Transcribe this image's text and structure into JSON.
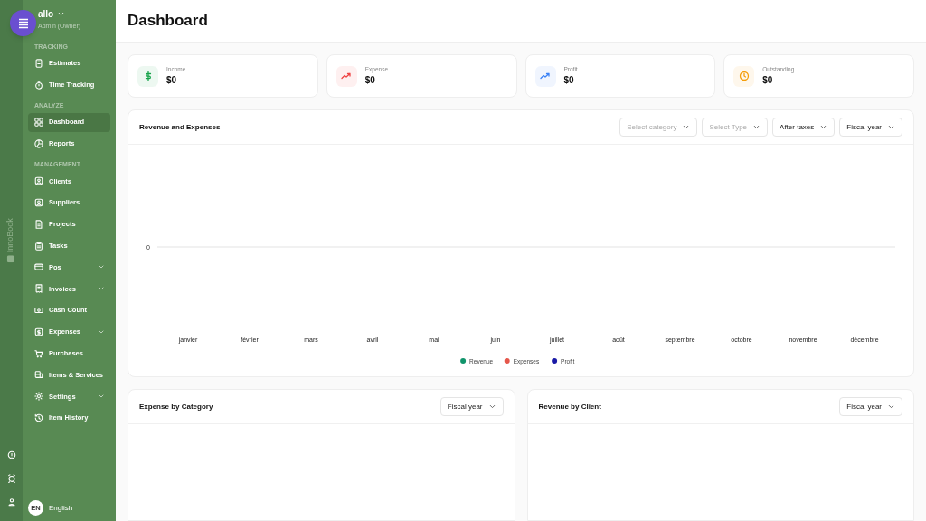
{
  "app": {
    "brand": "InnoBook"
  },
  "account": {
    "name": "allo",
    "role": "Admin (Owner)"
  },
  "sidebar": {
    "sections": [
      {
        "title": "TRACKING",
        "items": [
          {
            "label": "Estimates",
            "selected": false,
            "has_children": false
          },
          {
            "label": "Time Tracking",
            "selected": false,
            "has_children": false
          }
        ]
      },
      {
        "title": "ANALYZE",
        "items": [
          {
            "label": "Dashboard",
            "selected": true,
            "has_children": false
          },
          {
            "label": "Reports",
            "selected": false,
            "has_children": false
          }
        ]
      },
      {
        "title": "MANAGEMENT",
        "items": [
          {
            "label": "Clients",
            "selected": false,
            "has_children": false
          },
          {
            "label": "Suppliers",
            "selected": false,
            "has_children": false
          },
          {
            "label": "Projects",
            "selected": false,
            "has_children": false
          },
          {
            "label": "Tasks",
            "selected": false,
            "has_children": false
          },
          {
            "label": "Pos",
            "selected": false,
            "has_children": true
          },
          {
            "label": "Invoices",
            "selected": false,
            "has_children": true
          },
          {
            "label": "Cash Count",
            "selected": false,
            "has_children": false
          },
          {
            "label": "Expenses",
            "selected": false,
            "has_children": true
          },
          {
            "label": "Purchases",
            "selected": false,
            "has_children": false
          },
          {
            "label": "Items & Services",
            "selected": false,
            "has_children": false
          },
          {
            "label": "Settings",
            "selected": false,
            "has_children": true
          },
          {
            "label": "Item History",
            "selected": false,
            "has_children": false
          }
        ]
      }
    ]
  },
  "language": {
    "code": "EN",
    "label": "English"
  },
  "page_title": "Dashboard",
  "stats": [
    {
      "label": "Income",
      "value": "$0",
      "color": "#16a34a"
    },
    {
      "label": "Expense",
      "value": "$0",
      "color": "#ef4444"
    },
    {
      "label": "Profit",
      "value": "$0",
      "color": "#3b82f6"
    },
    {
      "label": "Outstanding",
      "value": "$0",
      "color": "#f59e0b"
    }
  ],
  "revenue_panel": {
    "title": "Revenue and Expenses",
    "filters": [
      {
        "text": "Select category",
        "placeholder": true
      },
      {
        "text": "Select Type",
        "placeholder": true
      },
      {
        "text": "After taxes",
        "placeholder": false
      },
      {
        "text": "Fiscal year",
        "placeholder": false
      }
    ],
    "chart": {
      "y_label": "0",
      "months": [
        "janvier",
        "février",
        "mars",
        "avril",
        "mai",
        "juin",
        "juillet",
        "août",
        "septembre",
        "octobre",
        "novembre",
        "décembre"
      ],
      "legend": [
        {
          "name": "Revenue",
          "color": "#10946b"
        },
        {
          "name": "Expenses",
          "color": "#e5574b"
        },
        {
          "name": "Profit",
          "color": "#1a1aa6"
        }
      ]
    }
  },
  "bottom_panels": [
    {
      "title": "Expense by Category",
      "filter": "Fiscal year"
    },
    {
      "title": "Revenue by Client",
      "filter": "Fiscal year"
    }
  ]
}
